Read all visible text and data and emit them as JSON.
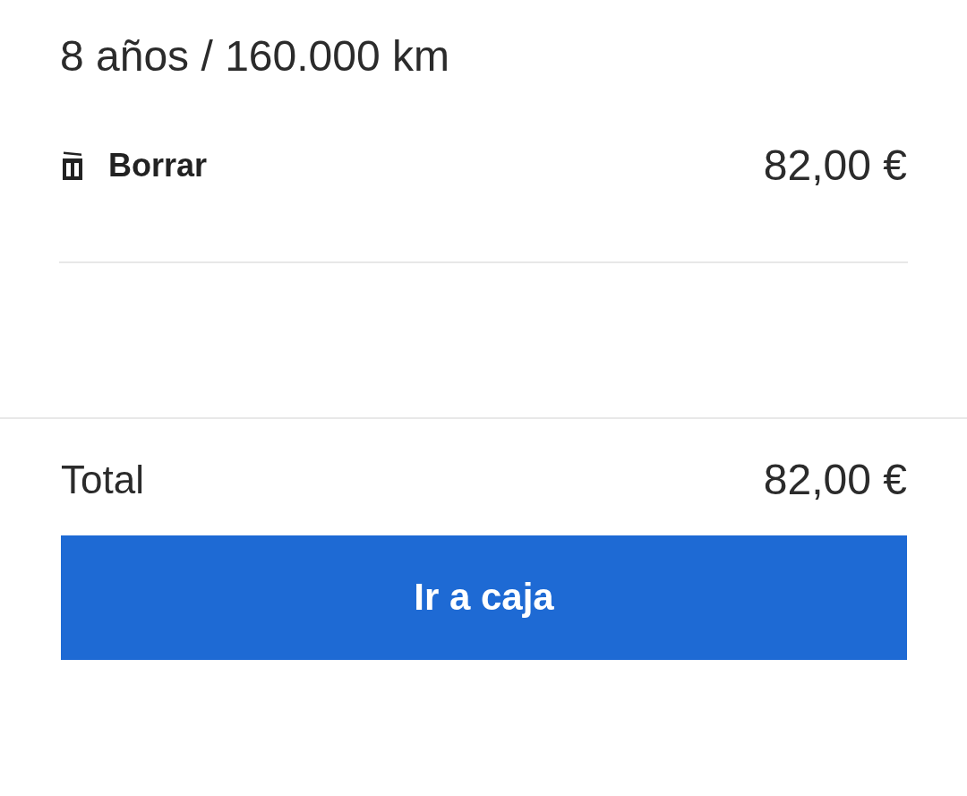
{
  "item": {
    "coverage": "8 años / 160.000 km",
    "delete_label": "Borrar",
    "price": "82,00 €"
  },
  "summary": {
    "total_label": "Total",
    "total_value": "82,00 €"
  },
  "checkout_button": {
    "label": "Ir a caja"
  }
}
